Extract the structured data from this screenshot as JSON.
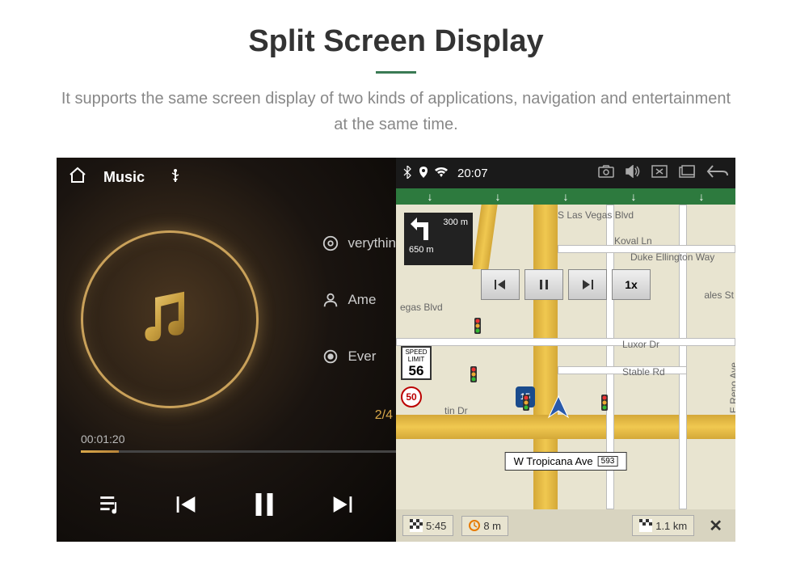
{
  "header": {
    "title": "Split Screen Display",
    "description": "It supports the same screen display of two kinds of applications, navigation and entertainment at the same time."
  },
  "music": {
    "title_label": "Music",
    "tracks": {
      "t1": "verythin",
      "t2": "Ame",
      "t3": "Ever"
    },
    "counter": "2/4",
    "elapsed": "00:01:20"
  },
  "status": {
    "time": "20:07"
  },
  "map": {
    "turn": {
      "near": "300 m",
      "far": "650 m"
    },
    "streets": {
      "s_las_vegas": "S Las Vegas Blvd",
      "koval": "Koval Ln",
      "duke": "Duke Ellington Way",
      "vegas_blvd": "egas Blvd",
      "ales": "ales St",
      "luxor": "Luxor Dr",
      "stable": "Stable Rd",
      "reno": "E Reno Ave",
      "tin": "tin Dr",
      "tropicana": "W Tropicana Ave",
      "tropicana_num": "593"
    },
    "speed": {
      "label": "SPEED\nLIMIT",
      "value": "56"
    },
    "hwy50": "50",
    "int15": "15",
    "controls": {
      "speed_btn": "1x"
    },
    "bottom": {
      "eta": "5:45",
      "min": "8 m",
      "dist": "1.1 km",
      "close": "✕"
    }
  }
}
